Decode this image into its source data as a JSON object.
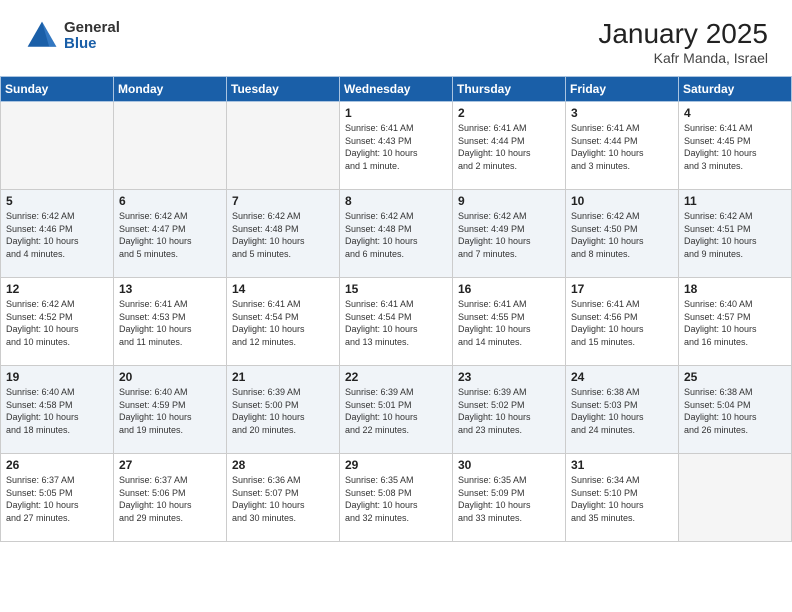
{
  "header": {
    "logo_general": "General",
    "logo_blue": "Blue",
    "month_title": "January 2025",
    "subtitle": "Kafr Manda, Israel"
  },
  "weekdays": [
    "Sunday",
    "Monday",
    "Tuesday",
    "Wednesday",
    "Thursday",
    "Friday",
    "Saturday"
  ],
  "weeks": [
    [
      {
        "day": "",
        "info": ""
      },
      {
        "day": "",
        "info": ""
      },
      {
        "day": "",
        "info": ""
      },
      {
        "day": "1",
        "info": "Sunrise: 6:41 AM\nSunset: 4:43 PM\nDaylight: 10 hours\nand 1 minute."
      },
      {
        "day": "2",
        "info": "Sunrise: 6:41 AM\nSunset: 4:44 PM\nDaylight: 10 hours\nand 2 minutes."
      },
      {
        "day": "3",
        "info": "Sunrise: 6:41 AM\nSunset: 4:44 PM\nDaylight: 10 hours\nand 3 minutes."
      },
      {
        "day": "4",
        "info": "Sunrise: 6:41 AM\nSunset: 4:45 PM\nDaylight: 10 hours\nand 3 minutes."
      }
    ],
    [
      {
        "day": "5",
        "info": "Sunrise: 6:42 AM\nSunset: 4:46 PM\nDaylight: 10 hours\nand 4 minutes."
      },
      {
        "day": "6",
        "info": "Sunrise: 6:42 AM\nSunset: 4:47 PM\nDaylight: 10 hours\nand 5 minutes."
      },
      {
        "day": "7",
        "info": "Sunrise: 6:42 AM\nSunset: 4:48 PM\nDaylight: 10 hours\nand 5 minutes."
      },
      {
        "day": "8",
        "info": "Sunrise: 6:42 AM\nSunset: 4:48 PM\nDaylight: 10 hours\nand 6 minutes."
      },
      {
        "day": "9",
        "info": "Sunrise: 6:42 AM\nSunset: 4:49 PM\nDaylight: 10 hours\nand 7 minutes."
      },
      {
        "day": "10",
        "info": "Sunrise: 6:42 AM\nSunset: 4:50 PM\nDaylight: 10 hours\nand 8 minutes."
      },
      {
        "day": "11",
        "info": "Sunrise: 6:42 AM\nSunset: 4:51 PM\nDaylight: 10 hours\nand 9 minutes."
      }
    ],
    [
      {
        "day": "12",
        "info": "Sunrise: 6:42 AM\nSunset: 4:52 PM\nDaylight: 10 hours\nand 10 minutes."
      },
      {
        "day": "13",
        "info": "Sunrise: 6:41 AM\nSunset: 4:53 PM\nDaylight: 10 hours\nand 11 minutes."
      },
      {
        "day": "14",
        "info": "Sunrise: 6:41 AM\nSunset: 4:54 PM\nDaylight: 10 hours\nand 12 minutes."
      },
      {
        "day": "15",
        "info": "Sunrise: 6:41 AM\nSunset: 4:54 PM\nDaylight: 10 hours\nand 13 minutes."
      },
      {
        "day": "16",
        "info": "Sunrise: 6:41 AM\nSunset: 4:55 PM\nDaylight: 10 hours\nand 14 minutes."
      },
      {
        "day": "17",
        "info": "Sunrise: 6:41 AM\nSunset: 4:56 PM\nDaylight: 10 hours\nand 15 minutes."
      },
      {
        "day": "18",
        "info": "Sunrise: 6:40 AM\nSunset: 4:57 PM\nDaylight: 10 hours\nand 16 minutes."
      }
    ],
    [
      {
        "day": "19",
        "info": "Sunrise: 6:40 AM\nSunset: 4:58 PM\nDaylight: 10 hours\nand 18 minutes."
      },
      {
        "day": "20",
        "info": "Sunrise: 6:40 AM\nSunset: 4:59 PM\nDaylight: 10 hours\nand 19 minutes."
      },
      {
        "day": "21",
        "info": "Sunrise: 6:39 AM\nSunset: 5:00 PM\nDaylight: 10 hours\nand 20 minutes."
      },
      {
        "day": "22",
        "info": "Sunrise: 6:39 AM\nSunset: 5:01 PM\nDaylight: 10 hours\nand 22 minutes."
      },
      {
        "day": "23",
        "info": "Sunrise: 6:39 AM\nSunset: 5:02 PM\nDaylight: 10 hours\nand 23 minutes."
      },
      {
        "day": "24",
        "info": "Sunrise: 6:38 AM\nSunset: 5:03 PM\nDaylight: 10 hours\nand 24 minutes."
      },
      {
        "day": "25",
        "info": "Sunrise: 6:38 AM\nSunset: 5:04 PM\nDaylight: 10 hours\nand 26 minutes."
      }
    ],
    [
      {
        "day": "26",
        "info": "Sunrise: 6:37 AM\nSunset: 5:05 PM\nDaylight: 10 hours\nand 27 minutes."
      },
      {
        "day": "27",
        "info": "Sunrise: 6:37 AM\nSunset: 5:06 PM\nDaylight: 10 hours\nand 29 minutes."
      },
      {
        "day": "28",
        "info": "Sunrise: 6:36 AM\nSunset: 5:07 PM\nDaylight: 10 hours\nand 30 minutes."
      },
      {
        "day": "29",
        "info": "Sunrise: 6:35 AM\nSunset: 5:08 PM\nDaylight: 10 hours\nand 32 minutes."
      },
      {
        "day": "30",
        "info": "Sunrise: 6:35 AM\nSunset: 5:09 PM\nDaylight: 10 hours\nand 33 minutes."
      },
      {
        "day": "31",
        "info": "Sunrise: 6:34 AM\nSunset: 5:10 PM\nDaylight: 10 hours\nand 35 minutes."
      },
      {
        "day": "",
        "info": ""
      }
    ]
  ]
}
